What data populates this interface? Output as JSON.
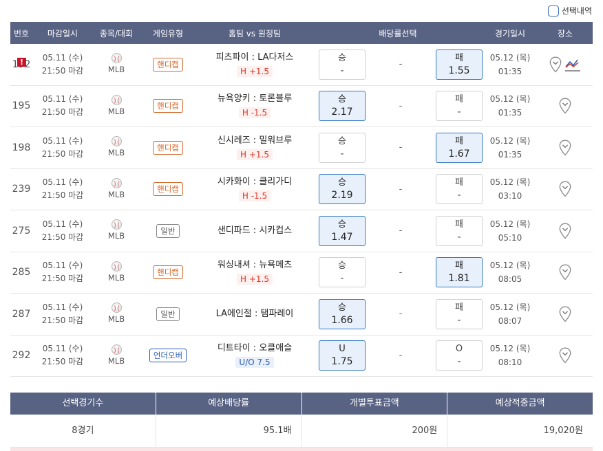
{
  "toggle": {
    "label": "선택내역"
  },
  "header": {
    "no": "번호",
    "close": "마감일시",
    "sport": "종목/대회",
    "type": "게임유형",
    "match": "홈팀 vs 원정팀",
    "odds": "배당률선택",
    "date": "경기일시",
    "place": "장소"
  },
  "rows": [
    {
      "no": "192",
      "warn": "!",
      "close_date": "05.11 (수)",
      "close_time": "21:50 마감",
      "league": "MLB",
      "type": "핸디캡",
      "type_kind": "handicap",
      "match": "피츠파이 : LA다저스",
      "sub": "H +1.5",
      "sub_kind": "handi",
      "left_label": "승",
      "left_val": "-",
      "left_sel": false,
      "mid": "-",
      "right_label": "패",
      "right_val": "1.55",
      "right_sel": true,
      "game_date": "05.12 (목)",
      "game_time": "01:35",
      "chart": true
    },
    {
      "no": "195",
      "close_date": "05.11 (수)",
      "close_time": "21:50 마감",
      "league": "MLB",
      "type": "핸디캡",
      "type_kind": "handicap",
      "match": "뉴욕양키 : 토론블루",
      "sub": "H -1.5",
      "sub_kind": "handi",
      "left_label": "승",
      "left_val": "2.17",
      "left_sel": true,
      "mid": "-",
      "right_label": "패",
      "right_val": "-",
      "right_sel": false,
      "game_date": "05.12 (목)",
      "game_time": "01:35"
    },
    {
      "no": "198",
      "close_date": "05.11 (수)",
      "close_time": "21:50 마감",
      "league": "MLB",
      "type": "핸디캡",
      "type_kind": "handicap",
      "match": "신시레즈 : 밀워브루",
      "sub": "H +1.5",
      "sub_kind": "handi",
      "left_label": "승",
      "left_val": "-",
      "left_sel": false,
      "mid": "-",
      "right_label": "패",
      "right_val": "1.67",
      "right_sel": true,
      "game_date": "05.12 (목)",
      "game_time": "01:35"
    },
    {
      "no": "239",
      "close_date": "05.11 (수)",
      "close_time": "21:50 마감",
      "league": "MLB",
      "type": "핸디캡",
      "type_kind": "handicap",
      "match": "시카화이 : 클리가디",
      "sub": "H -1.5",
      "sub_kind": "handi",
      "left_label": "승",
      "left_val": "2.19",
      "left_sel": true,
      "mid": "-",
      "right_label": "패",
      "right_val": "-",
      "right_sel": false,
      "game_date": "05.12 (목)",
      "game_time": "03:10"
    },
    {
      "no": "275",
      "close_date": "05.11 (수)",
      "close_time": "21:50 마감",
      "league": "MLB",
      "type": "일반",
      "type_kind": "normal",
      "match": "샌디파드 : 시카컵스",
      "sub": "",
      "sub_kind": "",
      "left_label": "승",
      "left_val": "1.47",
      "left_sel": true,
      "mid": "-",
      "right_label": "패",
      "right_val": "-",
      "right_sel": false,
      "game_date": "05.12 (목)",
      "game_time": "05:10"
    },
    {
      "no": "285",
      "close_date": "05.11 (수)",
      "close_time": "21:50 마감",
      "league": "MLB",
      "type": "핸디캡",
      "type_kind": "handicap",
      "match": "워싱내셔 : 뉴욕메츠",
      "sub": "H +1.5",
      "sub_kind": "handi",
      "left_label": "승",
      "left_val": "-",
      "left_sel": false,
      "mid": "-",
      "right_label": "패",
      "right_val": "1.81",
      "right_sel": true,
      "game_date": "05.12 (목)",
      "game_time": "08:05"
    },
    {
      "no": "287",
      "close_date": "05.11 (수)",
      "close_time": "21:50 마감",
      "league": "MLB",
      "type": "일반",
      "type_kind": "normal",
      "match": "LA에인절 : 탬파레이",
      "sub": "",
      "sub_kind": "",
      "left_label": "승",
      "left_val": "1.66",
      "left_sel": true,
      "mid": "-",
      "right_label": "패",
      "right_val": "-",
      "right_sel": false,
      "game_date": "05.12 (목)",
      "game_time": "08:07"
    },
    {
      "no": "292",
      "close_date": "05.11 (수)",
      "close_time": "21:50 마감",
      "league": "MLB",
      "type": "언더오버",
      "type_kind": "ou",
      "match": "디트타이 : 오클애슬",
      "sub": "U/O 7.5",
      "sub_kind": "ou",
      "left_label": "U",
      "left_val": "1.75",
      "left_sel": true,
      "mid": "-",
      "right_label": "O",
      "right_val": "-",
      "right_sel": false,
      "game_date": "05.12 (목)",
      "game_time": "08:10"
    }
  ],
  "summary": {
    "headers": [
      "선택경기수",
      "예상배당률",
      "개별투표금액",
      "예상적중금액"
    ],
    "values": [
      "8경기",
      "95.1배",
      "200원",
      "19,020원"
    ]
  },
  "colors": {
    "header_bg": "#586283",
    "selected_bg": "#e8f1fb",
    "selected_border": "#2f77c4",
    "handicap": "#d4672a",
    "handicap_sub": "#d9382a",
    "ou": "#2a5db0",
    "warn": "#c8142b"
  },
  "icons": [
    "baseball-icon",
    "map-pin-icon",
    "trend-chart-icon",
    "warning-icon",
    "checkbox-icon"
  ]
}
